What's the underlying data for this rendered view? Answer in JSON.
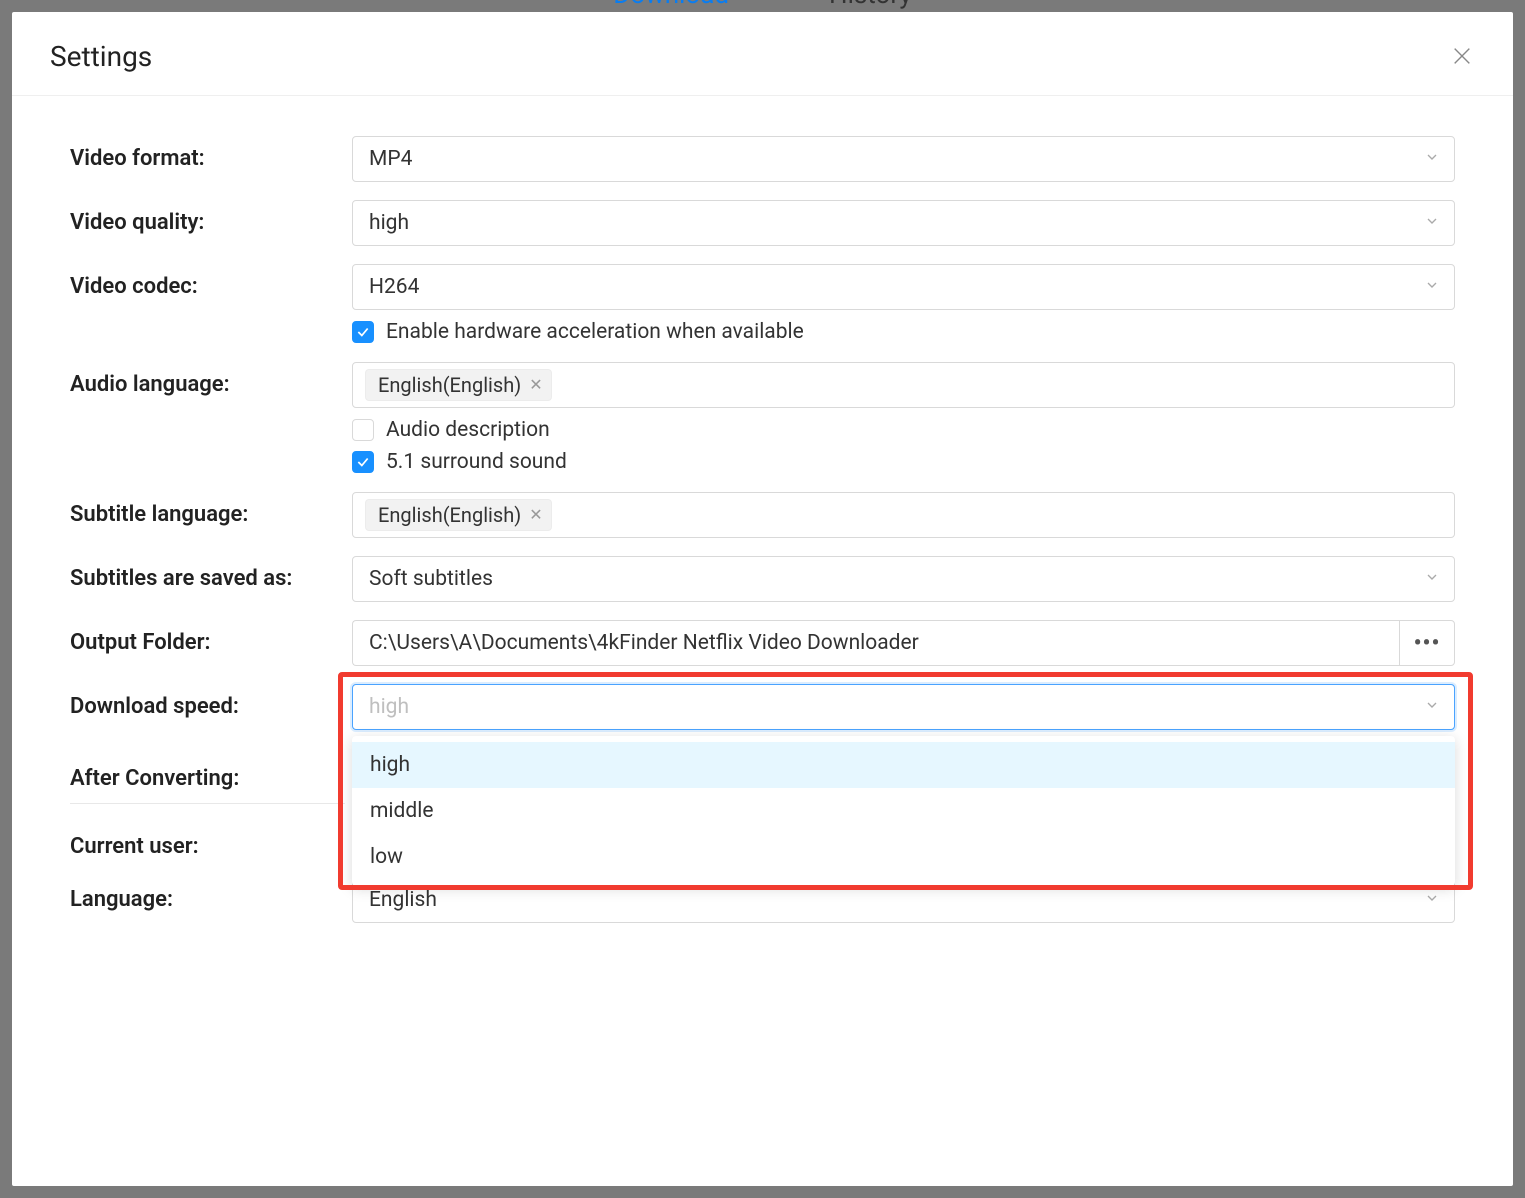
{
  "background": {
    "tab_download": "Download",
    "tab_history": "History"
  },
  "header": {
    "title": "Settings"
  },
  "labels": {
    "video_format": "Video format:",
    "video_quality": "Video quality:",
    "video_codec": "Video codec:",
    "audio_language": "Audio language:",
    "subtitle_language": "Subtitle language:",
    "subtitles_saved_as": "Subtitles are saved as:",
    "output_folder": "Output Folder:",
    "download_speed": "Download speed:",
    "after_converting": "After Converting:",
    "current_user": "Current user:",
    "language": "Language:"
  },
  "values": {
    "video_format": "MP4",
    "video_quality": "high",
    "video_codec": "H264",
    "hw_accel_label": "Enable hardware acceleration when available",
    "hw_accel_checked": true,
    "audio_language_tag": "English(English)",
    "audio_description_label": "Audio description",
    "audio_description_checked": false,
    "surround_label": "5.1 surround sound",
    "surround_checked": true,
    "subtitle_language_tag": "English(English)",
    "subtitles_saved_as": "Soft subtitles",
    "output_folder": "C:\\Users\\A\\Documents\\4kFinder Netflix Video Downloader",
    "download_speed_placeholder": "high",
    "language": "English"
  },
  "download_speed_options": [
    "high",
    "middle",
    "low"
  ],
  "colors": {
    "accent": "#1890ff",
    "highlight": "#f13b2f",
    "focus": "#4aa3ff"
  }
}
